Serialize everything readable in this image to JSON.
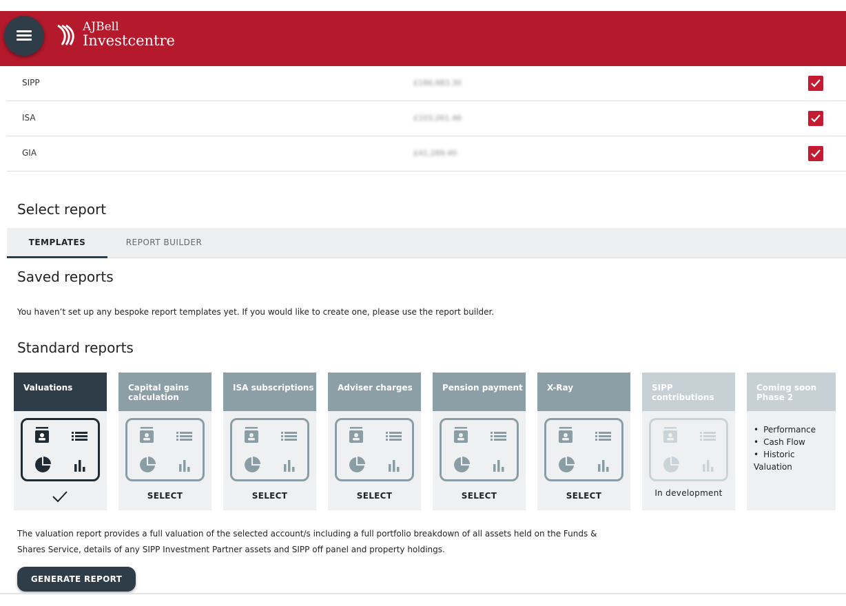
{
  "header": {
    "brand_line1": "AJBell",
    "brand_line2": "Investcentre",
    "menu_icon": "hamburger-icon",
    "brand_color": "#b51a2c"
  },
  "accounts": [
    {
      "name": "SIPP",
      "value": "£186,983.30",
      "checked": true
    },
    {
      "name": "ISA",
      "value": "£103,261.46",
      "checked": true
    },
    {
      "name": "GIA",
      "value": "£41,289.40",
      "checked": true
    }
  ],
  "select_report": {
    "title": "Select report",
    "tabs": [
      {
        "label": "TEMPLATES",
        "active": true
      },
      {
        "label": "REPORT BUILDER",
        "active": false
      }
    ]
  },
  "saved_reports": {
    "title": "Saved reports",
    "message": "You haven’t set up any bespoke report templates yet. If you would like to create one, please use the report builder."
  },
  "standard_reports": {
    "title": "Standard reports",
    "cards": [
      {
        "title": "Valuations",
        "state": "selected",
        "action": ""
      },
      {
        "title": "Capital gains calculation",
        "state": "normal",
        "action": "SELECT"
      },
      {
        "title": "ISA subscriptions",
        "state": "normal",
        "action": "SELECT"
      },
      {
        "title": "Adviser charges",
        "state": "normal",
        "action": "SELECT"
      },
      {
        "title": "Pension payment",
        "state": "normal",
        "action": "SELECT"
      },
      {
        "title": "X-Ray",
        "state": "normal",
        "action": "SELECT"
      },
      {
        "title": "SIPP contributions",
        "state": "dim",
        "action": "In development"
      }
    ],
    "coming_soon": {
      "title": "Coming soon Phase 2",
      "items": [
        "Performance",
        "Cash Flow",
        "Historic Valuation"
      ]
    }
  },
  "description": {
    "line1": "The valuation report provides a full valuation of the selected account/s including a full portfolio breakdown of all assets held on the Funds &",
    "line2": "Shares Service, details of any SIPP Investment Partner assets and SIPP off panel and property holdings."
  },
  "generate_button": {
    "label": "GENERATE REPORT"
  }
}
